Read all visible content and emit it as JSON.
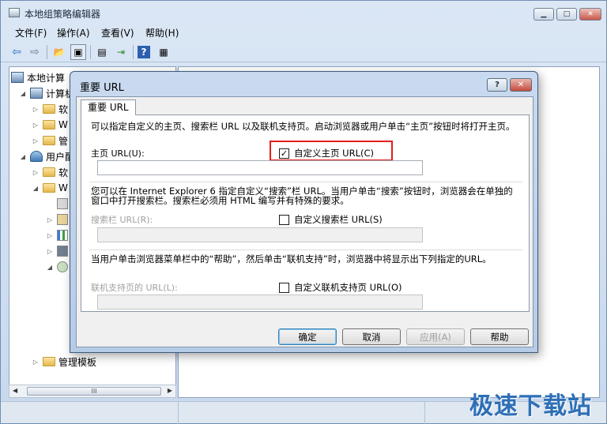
{
  "window": {
    "title": "本地组策略编辑器",
    "minimize_label": "▁",
    "maximize_label": "□",
    "close_label": "✕"
  },
  "menu": [
    "文件(F)",
    "操作(A)",
    "查看(V)",
    "帮助(H)"
  ],
  "toolbar": {
    "back_icon": "⇦",
    "forward_icon": "⇨",
    "up_icon": "📂",
    "show_hide_icon": "▣",
    "properties_icon": "▤",
    "export_icon": "⇥",
    "help_icon": "?",
    "view_icon": "▦"
  },
  "tree": {
    "root": "本地计算",
    "computer_config": "计算机",
    "c_item1": "软",
    "c_item2": "W",
    "c_item3": "管",
    "user_config": "用户配",
    "u_item1": "软",
    "u_item2": "W",
    "admin_templates": "管理模板"
  },
  "scroll": {
    "left_arrow": "◀",
    "right_arrow": "▶",
    "grip": "III"
  },
  "watermark": "极速下载站",
  "dialog": {
    "title": "重要 URL",
    "help_label": "?",
    "close_label": "✕",
    "tab_label": "重要 URL",
    "home_desc": "可以指定自定义的主页、搜索栏 URL 以及联机支持页。启动浏览器或用户单击“主页”按钮时将打开主页。",
    "home_label": "主页 URL(U):",
    "home_check_label": "自定义主页 URL(C)",
    "home_check_mark": "✓",
    "search_desc": "您可以在 Internet Explorer 6 指定自定义“搜索”栏 URL。当用户单击“搜索”按钮时，浏览器会在单独的窗口中打开搜索栏。搜索栏必须用 HTML 编写并有特殊的要求。",
    "search_label": "搜索栏 URL(R):",
    "search_check_label": "自定义搜索栏 URL(S)",
    "support_desc": "当用户单击浏览器菜单栏中的“帮助”，然后单击“联机支持”时，浏览器中将显示出下列指定的URL。",
    "support_label": "联机支持页的 URL(L):",
    "support_check_label": "自定义联机支持页 URL(O)",
    "buttons": {
      "ok": "确定",
      "cancel": "取消",
      "apply": "应用(A)",
      "help": "帮助"
    }
  }
}
